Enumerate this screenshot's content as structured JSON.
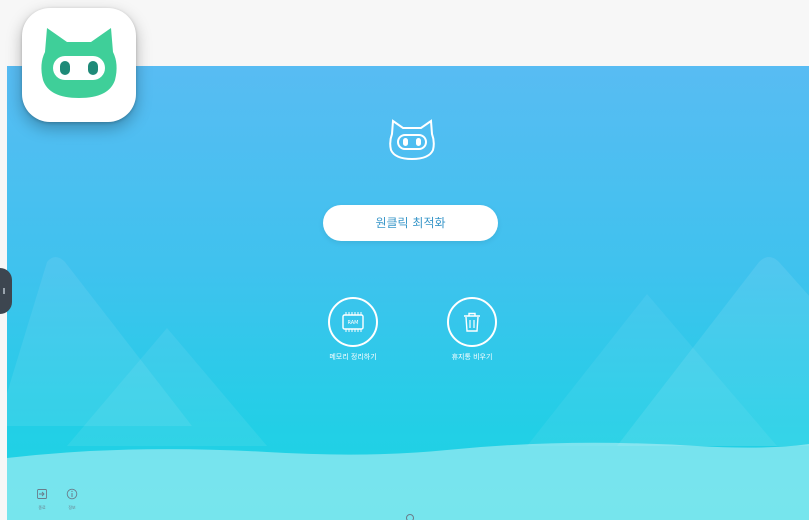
{
  "main": {
    "optimize_button_label": "원클릭 최적화",
    "actions": [
      {
        "label": "메모리 정리하기",
        "icon": "ram-chip-icon",
        "chip_text": "RAM"
      },
      {
        "label": "휴지통 비우기",
        "icon": "trash-icon"
      }
    ]
  },
  "footer": {
    "exit_label": "종료",
    "info_label": "정보"
  },
  "icons": {
    "app_icon": "cat-robot-icon",
    "mascot": "cat-robot-icon",
    "exit": "exit-icon",
    "info": "info-icon"
  },
  "colors": {
    "background_top": "#58bcf3",
    "background_bottom": "#1ed6e2",
    "app_icon_green": "#3fcf99",
    "button_text": "#3a97c9"
  }
}
